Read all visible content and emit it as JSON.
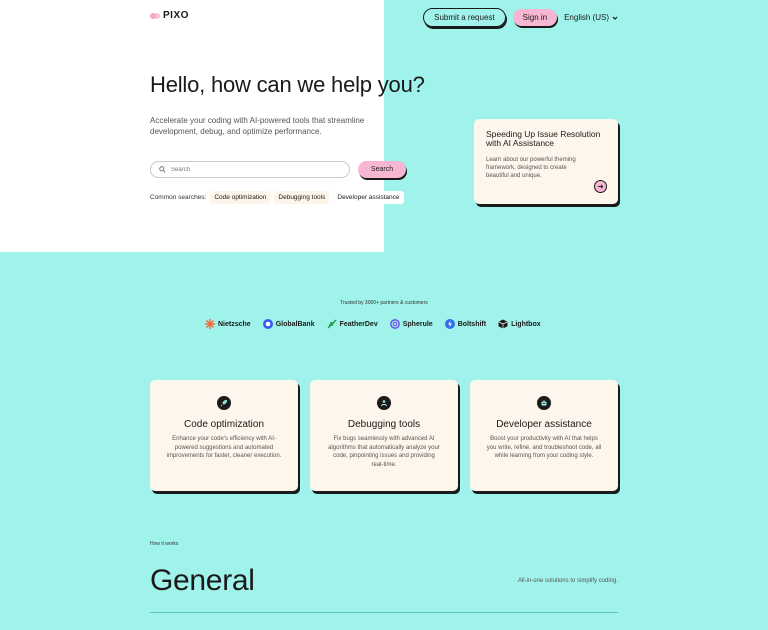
{
  "brand": {
    "name": "PIXO"
  },
  "nav": {
    "submit_label": "Submit a request",
    "signin_label": "Sign in",
    "language": "English (US)"
  },
  "hero": {
    "title": "Hello, how can we help you?",
    "subtitle": "Accelerate your coding with AI-powered tools that streamline development, debug, and optimize performance.",
    "search_placeholder": "Search",
    "search_button": "Search",
    "common_label": "Common searches:",
    "common": [
      "Code optimization",
      "Debugging tools",
      "Developer assistance"
    ]
  },
  "promo": {
    "title": "Speeding Up Issue Resolution with AI Assistance",
    "description": "Learn about our powerful theming framework, designed to create beautiful and unique."
  },
  "trusted": {
    "label": "Trusted by 3000+ partners & customers",
    "logos": [
      "Nietzsche",
      "GlobalBank",
      "FeatherDev",
      "Spherule",
      "Boltshift",
      "Lightbox"
    ]
  },
  "features": [
    {
      "title": "Code optimization",
      "description": "Enhance your code's efficiency with AI-powered suggestions and automated improvements for faster, cleaner execution.",
      "icon": "rocket-icon"
    },
    {
      "title": "Debugging tools",
      "description": "Fix bugs seamlessly with advanced AI algorithms that automatically analyze your code, pinpointing issues and providing real-time.",
      "icon": "users-icon"
    },
    {
      "title": "Developer assistance",
      "description": "Boost your productivity with AI that helps you write, refine, and troubleshoot code, all while learning from your coding style.",
      "icon": "robot-icon"
    }
  ],
  "how": {
    "label": "How it works",
    "title": "General",
    "tagline": "All-in-one solutions to simplify coding."
  },
  "colors": {
    "background": "#a0f3ea",
    "accent_pink": "#f7b6d2",
    "card": "#fdf6ec",
    "ink": "#1a1a1a"
  }
}
